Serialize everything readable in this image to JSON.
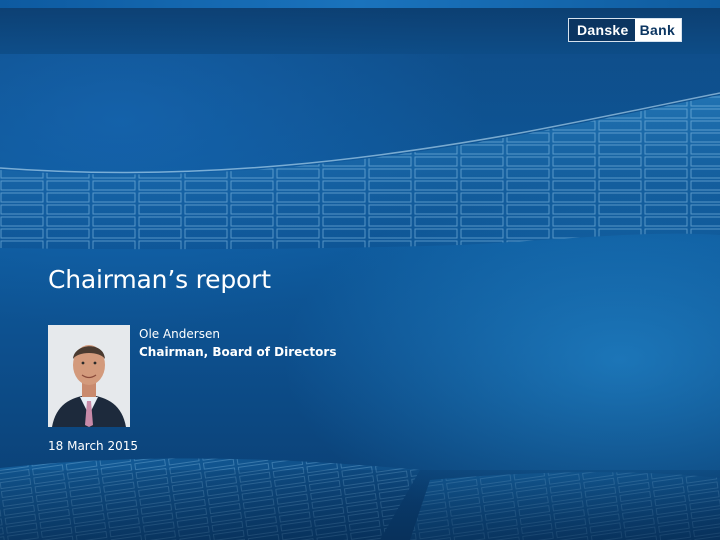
{
  "brand": {
    "logo_left": "Danske",
    "logo_right": "Bank"
  },
  "slide": {
    "title": "Chairman’s report",
    "presenter_name": "Ole Andersen",
    "presenter_role": "Chairman, Board of Directors",
    "date": "18 March 2015"
  },
  "colors": {
    "background": "#0d4f8d",
    "logo_dark": "#0b3561",
    "text": "#ffffff"
  }
}
